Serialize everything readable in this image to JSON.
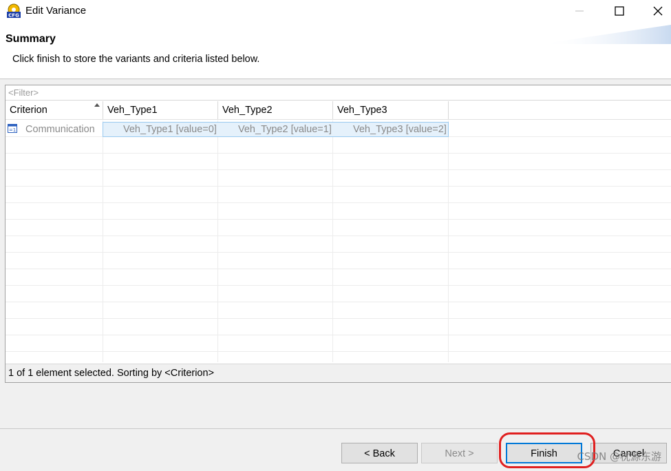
{
  "window": {
    "title": "Edit Variance",
    "app_icon": "cfg-icon"
  },
  "header": {
    "title": "Summary",
    "description": "Click finish to store the variants and criteria listed below."
  },
  "table": {
    "filter_placeholder": "<Filter>",
    "columns": [
      "Criterion",
      "Veh_Type1",
      "Veh_Type2",
      "Veh_Type3"
    ],
    "sort_column": "Criterion",
    "sort_direction": "ascending",
    "rows": [
      {
        "criterion": "Communication",
        "icon": "criterion-icon",
        "veh_type1": "Veh_Type1 [value=0]",
        "veh_type2": "Veh_Type2 [value=1]",
        "veh_type3": "Veh_Type3 [value=2]",
        "selected": true
      }
    ],
    "status": "1 of 1 element selected. Sorting by <Criterion>"
  },
  "buttons": {
    "back": "< Back",
    "next": "Next >",
    "finish": "Finish",
    "cancel": "Cancel"
  },
  "watermark": "CSDN @枕源东游",
  "colors": {
    "accent": "#0078d7",
    "selection": "#e5f1fb",
    "highlight_ring": "#e02020"
  }
}
